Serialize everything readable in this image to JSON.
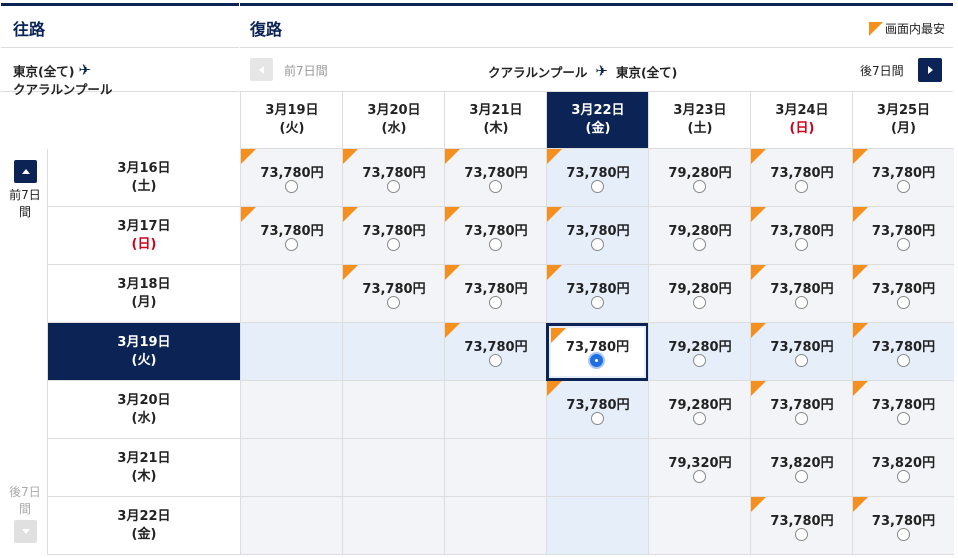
{
  "header": {
    "outbound_title": "往路",
    "return_title": "復路",
    "legend_label": "画面内最安"
  },
  "route_left": {
    "from": "東京(全て)",
    "to": "クアラルンプール"
  },
  "route_right": {
    "prev_label": "前7日間",
    "from": "クアラルンプール",
    "to": "東京(全て)",
    "next_label": "後7日間"
  },
  "side_nav": {
    "prev_label": "前7日間",
    "next_label": "後7日間"
  },
  "columns": [
    {
      "date": "3月19日",
      "dow": "(火)",
      "sunday": false,
      "selected": false
    },
    {
      "date": "3月20日",
      "dow": "(水)",
      "sunday": false,
      "selected": false
    },
    {
      "date": "3月21日",
      "dow": "(木)",
      "sunday": false,
      "selected": false
    },
    {
      "date": "3月22日",
      "dow": "(金)",
      "sunday": false,
      "selected": true
    },
    {
      "date": "3月23日",
      "dow": "(土)",
      "sunday": false,
      "selected": false
    },
    {
      "date": "3月24日",
      "dow": "(日)",
      "sunday": true,
      "selected": false
    },
    {
      "date": "3月25日",
      "dow": "(月)",
      "sunday": false,
      "selected": false
    }
  ],
  "rows": [
    {
      "date": "3月16日",
      "dow": "(土)",
      "sunday": false,
      "selected": false,
      "cells": [
        {
          "price": "73,780円",
          "cheapest": true
        },
        {
          "price": "73,780円",
          "cheapest": true
        },
        {
          "price": "73,780円",
          "cheapest": true
        },
        {
          "price": "73,780円",
          "cheapest": true
        },
        {
          "price": "79,280円",
          "cheapest": false
        },
        {
          "price": "73,780円",
          "cheapest": true
        },
        {
          "price": "73,780円",
          "cheapest": true
        }
      ]
    },
    {
      "date": "3月17日",
      "dow": "(日)",
      "sunday": true,
      "selected": false,
      "cells": [
        {
          "price": "73,780円",
          "cheapest": true
        },
        {
          "price": "73,780円",
          "cheapest": true
        },
        {
          "price": "73,780円",
          "cheapest": true
        },
        {
          "price": "73,780円",
          "cheapest": true
        },
        {
          "price": "79,280円",
          "cheapest": false
        },
        {
          "price": "73,780円",
          "cheapest": true
        },
        {
          "price": "73,780円",
          "cheapest": true
        }
      ]
    },
    {
      "date": "3月18日",
      "dow": "(月)",
      "sunday": false,
      "selected": false,
      "cells": [
        null,
        {
          "price": "73,780円",
          "cheapest": true
        },
        {
          "price": "73,780円",
          "cheapest": true
        },
        {
          "price": "73,780円",
          "cheapest": true
        },
        {
          "price": "79,280円",
          "cheapest": false
        },
        {
          "price": "73,780円",
          "cheapest": true
        },
        {
          "price": "73,780円",
          "cheapest": true
        }
      ]
    },
    {
      "date": "3月19日",
      "dow": "(火)",
      "sunday": false,
      "selected": true,
      "cells": [
        null,
        null,
        {
          "price": "73,780円",
          "cheapest": true
        },
        {
          "price": "73,780円",
          "cheapest": true,
          "selected": true
        },
        {
          "price": "79,280円",
          "cheapest": false
        },
        {
          "price": "73,780円",
          "cheapest": true
        },
        {
          "price": "73,780円",
          "cheapest": true
        }
      ]
    },
    {
      "date": "3月20日",
      "dow": "(水)",
      "sunday": false,
      "selected": false,
      "cells": [
        null,
        null,
        null,
        {
          "price": "73,780円",
          "cheapest": true
        },
        {
          "price": "79,280円",
          "cheapest": false
        },
        {
          "price": "73,780円",
          "cheapest": true
        },
        {
          "price": "73,780円",
          "cheapest": true
        }
      ]
    },
    {
      "date": "3月21日",
      "dow": "(木)",
      "sunday": false,
      "selected": false,
      "cells": [
        null,
        null,
        null,
        null,
        {
          "price": "79,320円",
          "cheapest": false
        },
        {
          "price": "73,820円",
          "cheapest": false
        },
        {
          "price": "73,820円",
          "cheapest": false
        }
      ]
    },
    {
      "date": "3月22日",
      "dow": "(金)",
      "sunday": false,
      "selected": false,
      "cells": [
        null,
        null,
        null,
        null,
        null,
        {
          "price": "73,780円",
          "cheapest": true
        },
        {
          "price": "73,780円",
          "cheapest": true
        }
      ]
    }
  ]
}
